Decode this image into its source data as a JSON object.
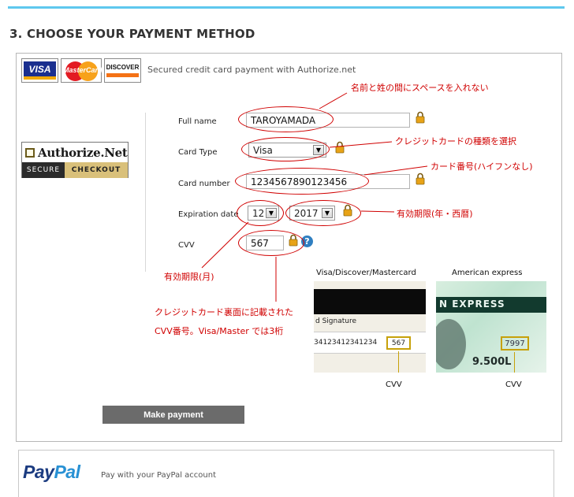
{
  "section_title": "3. CHOOSE YOUR PAYMENT METHOD",
  "credit_card": {
    "logos": [
      "VISA",
      "MasterCard",
      "DISCOVER"
    ],
    "secured_text": "Secured credit card payment with Authorize.net",
    "badge": {
      "name": "Authorize.Net",
      "left": "SECURE",
      "right": "CHECKOUT"
    }
  },
  "form": {
    "full_name_label": "Full name",
    "full_name_value": "TAROYAMADA",
    "card_type_label": "Card Type",
    "card_type_value": "Visa",
    "card_number_label": "Card number",
    "card_number_value": "1234567890123456",
    "expiration_label": "Expiration date",
    "exp_month_value": "12",
    "exp_year_value": "2017",
    "cvv_label": "CVV",
    "cvv_value": "567",
    "help": "?"
  },
  "notes": {
    "name": "名前と姓の間にスペースを入れない",
    "card_type": "クレジットカードの種類を選択",
    "card_number": "カード番号(ハイフンなし)",
    "expiry_year": "有効期限(年・西暦)",
    "expiry_month": "有効期限(月)",
    "cvv_line1": "クレジットカード裏面に記載された",
    "cvv_line2": "CVV番号。Visa/Master では3桁"
  },
  "cvv_samples": {
    "visa_title": "Visa/Discover/Mastercard",
    "amex_title": "American express",
    "visa_sig": "d Signature",
    "visa_digits": "34123412341234",
    "visa_cvv": "567",
    "amex_express": "N EXPRESS",
    "amex_cvv": "7997",
    "amex_num": "9.500L",
    "cvv_caption": "CVV"
  },
  "make_payment_label": "Make payment",
  "paypal": {
    "logo_part1": "Pay",
    "logo_part2": "Pal",
    "text": "Pay with your PayPal account"
  },
  "colors": {
    "accent_rule": "#5ec8ee",
    "annotation": "#d00000",
    "button": "#6b6b6b",
    "lock": "#e8a317"
  }
}
